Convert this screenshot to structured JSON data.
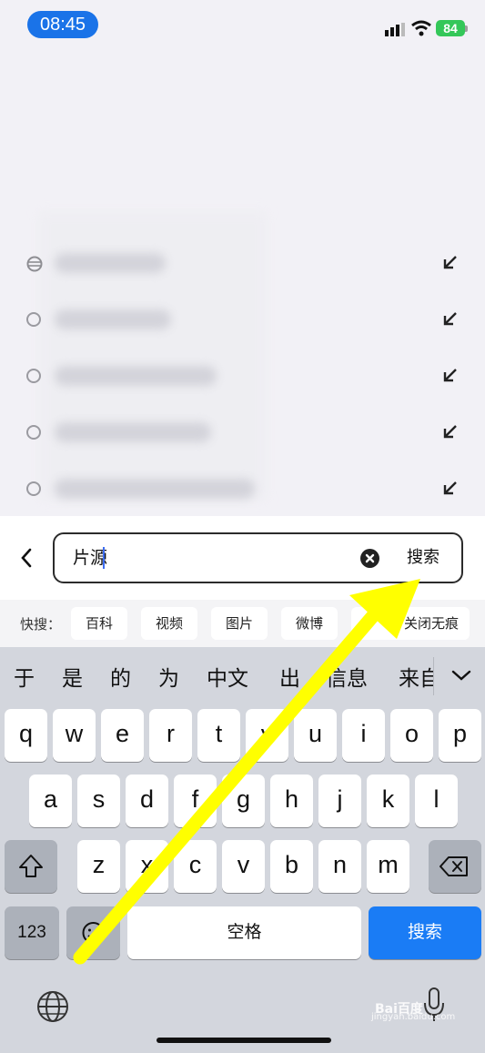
{
  "status_bar": {
    "time": "08:45",
    "battery": "84",
    "signal_icon": "cellular-signal-icon",
    "wifi_icon": "wifi-icon"
  },
  "suggestions": [
    {
      "icon": "globe-icon",
      "arrow_icon": "fill-arrow-icon"
    },
    {
      "icon": "history-icon",
      "arrow_icon": "fill-arrow-icon"
    },
    {
      "icon": "history-icon",
      "arrow_icon": "fill-arrow-icon"
    },
    {
      "icon": "history-icon",
      "arrow_icon": "fill-arrow-icon"
    },
    {
      "icon": "history-icon",
      "arrow_icon": "fill-arrow-icon"
    }
  ],
  "search": {
    "back_icon": "chevron-left-icon",
    "query": "片源",
    "clear_icon": "clear-icon",
    "action_label": "搜索"
  },
  "quick_search": {
    "label": "快搜：",
    "chips": [
      "百科",
      "视频",
      "图片",
      "微博",
      "关闭无痕"
    ]
  },
  "keyboard": {
    "candidates": [
      "于",
      "是",
      "的",
      "为",
      "中文",
      "出",
      "信息",
      "来自"
    ],
    "row1": [
      "q",
      "w",
      "e",
      "r",
      "t",
      "y",
      "u",
      "i",
      "o",
      "p"
    ],
    "row2": [
      "a",
      "s",
      "d",
      "f",
      "g",
      "h",
      "j",
      "k",
      "l"
    ],
    "row3": [
      "z",
      "x",
      "c",
      "v",
      "b",
      "n",
      "m"
    ],
    "numbers_label": "123",
    "space_label": "空格",
    "search_label": "搜索",
    "shift_icon": "shift-icon",
    "delete_icon": "backspace-icon",
    "emoji_icon": "emoji-icon",
    "globe_icon": "globe-icon",
    "mic_icon": "microphone-icon"
  },
  "watermark": {
    "logo": "Bai百度",
    "text": "jingyan.baidu.com"
  },
  "colors": {
    "accent": "#1a7cf5",
    "status_pill": "#1a73e8",
    "battery": "#34c759",
    "annotation_arrow": "#ffff00"
  }
}
